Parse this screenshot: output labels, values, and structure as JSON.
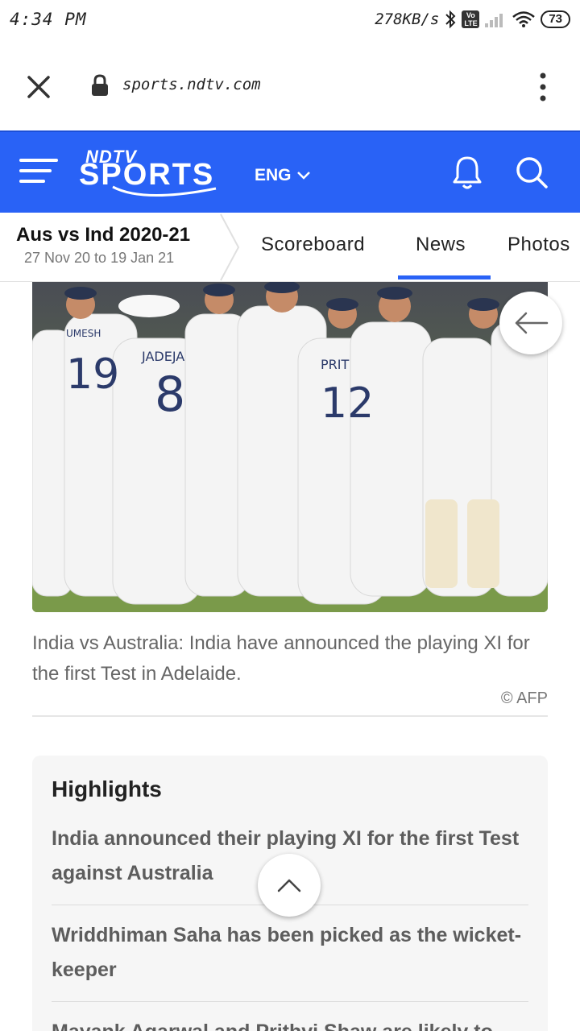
{
  "status_bar": {
    "time": "4:34 PM",
    "net_speed": "278KB/s",
    "battery": "73",
    "volte_label": "Vo LTE",
    "icons": [
      "bluetooth-icon",
      "volte-icon",
      "signal-icon",
      "wifi-icon",
      "battery-icon"
    ]
  },
  "browser": {
    "url": "sports.ndtv.com",
    "icons": [
      "close-icon",
      "lock-icon",
      "more-vert-icon"
    ]
  },
  "header": {
    "logo_top": "NDTV",
    "logo_main": "SPORTS",
    "language": "ENG",
    "brand_color": "#2962f6",
    "icons": [
      "hamburger-menu-icon",
      "chevron-down-icon",
      "bell-icon",
      "search-icon"
    ]
  },
  "series": {
    "title": "Aus vs Ind 2020-21",
    "dates": "27 Nov 20 to 19 Jan 21",
    "tabs": [
      {
        "label": "Scoreboard",
        "active": false
      },
      {
        "label": "News",
        "active": true
      },
      {
        "label": "Photos",
        "active": false
      }
    ]
  },
  "article": {
    "image_jersey_names": [
      "UMESH",
      "JADEJA",
      "PRIT"
    ],
    "image_jersey_numbers": [
      "19",
      "8",
      "12"
    ],
    "caption": "India vs Australia: India have announced the playing XI for the first Test in Adelaide.",
    "credit": "© AFP"
  },
  "highlights": {
    "title": "Highlights",
    "items": [
      "India announced their playing XI for the first Test against Australia",
      "Wriddhiman Saha has been picked as the wicket-keeper",
      "Mayank Agarwal and Prithvi Shaw are likely to"
    ]
  },
  "fabs": {
    "icons": [
      "arrow-left-icon",
      "chevron-up-icon"
    ]
  }
}
